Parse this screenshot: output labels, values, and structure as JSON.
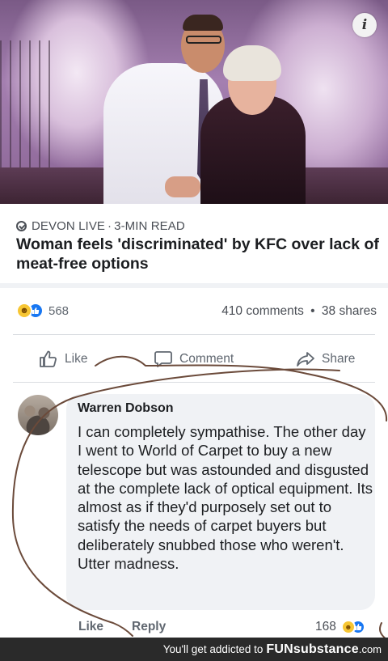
{
  "article": {
    "photo_info_icon": "info-icon",
    "source": "DEVON LIVE",
    "read_time": "3-MIN READ",
    "source_separator": "·",
    "headline": "Woman feels 'discriminated' by KFC over lack of meat-free options"
  },
  "reactions": {
    "icons": [
      "haha-icon",
      "like-icon"
    ],
    "count": "568",
    "comments": "410 comments",
    "separator": "•",
    "shares": "38 shares"
  },
  "actions": {
    "like": "Like",
    "comment": "Comment",
    "share": "Share"
  },
  "comment": {
    "author": "Warren Dobson",
    "text": "I can completely sympathise. The other day I went to World of Carpet to buy a new telescope but was astounded and disgusted at the complete lack of optical equipment. Its almost as if they'd purposely set out to satisfy the needs of carpet buyers but deliberately snubbed those who weren't. Utter madness.",
    "like_label": "Like",
    "reply_label": "Reply",
    "reaction_count": "168",
    "reaction_icons": [
      "haha-icon",
      "like-icon"
    ]
  },
  "footer": {
    "tagline": "You'll get addicted to",
    "brand": "FUNsubstance",
    "brand_ext": ".com"
  },
  "colors": {
    "accent_blue": "#1877f2",
    "haha_yellow": "#f7c633",
    "annotation_stroke": "#6b4a3a",
    "footer_bg": "#2a2a2a"
  }
}
